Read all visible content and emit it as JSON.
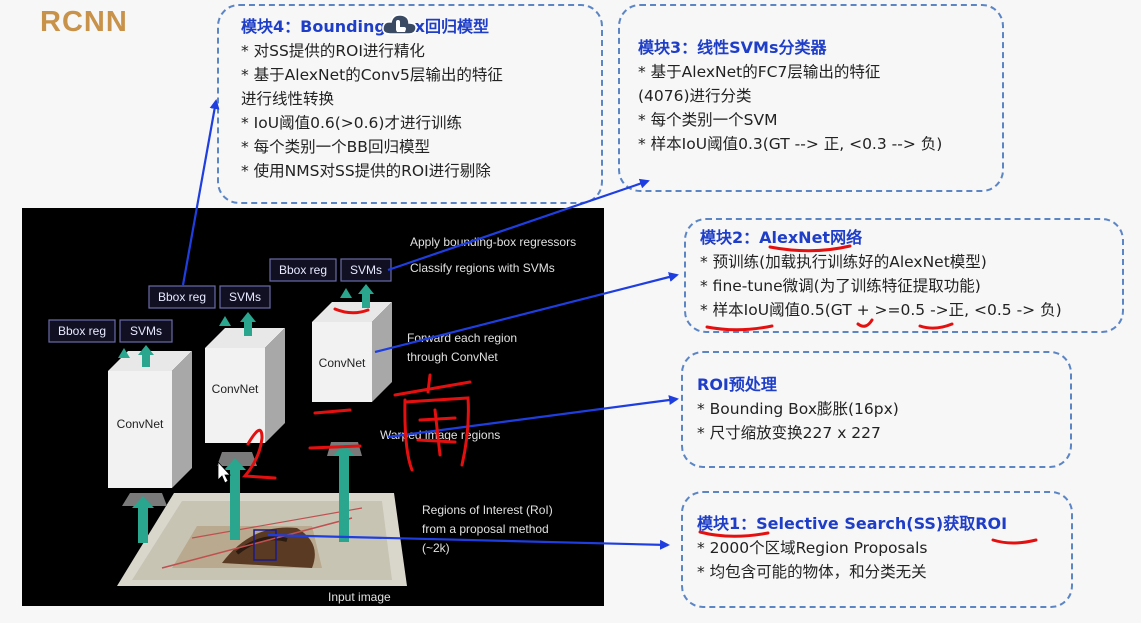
{
  "title": "RCNN",
  "module4": {
    "head": "模块4：Bounding Box回归模型",
    "lines": [
      "* 对SS提供的ROI进行精化",
      "* 基于AlexNet的Conv5层输出的特征",
      "进行线性转换",
      "* IoU阈值0.6(>0.6)才进行训练",
      "* 每个类别一个BB回归模型",
      "* 使用NMS对SS提供的ROI进行剔除"
    ]
  },
  "module3": {
    "head": "模块3：线性SVMs分类器",
    "lines": [
      "* 基于AlexNet的FC7层输出的特征",
      "(4076)进行分类",
      "* 每个类别一个SVM",
      "* 样本IoU阈值0.3(GT --> 正, <0.3 --> 负)"
    ]
  },
  "module2": {
    "head": "模块2：AlexNet网络",
    "lines": [
      "* 预训练(加载执行训练好的AlexNet模型)",
      "* fine-tune微调(为了训练特征提取功能)",
      "* 样本IoU阈值0.5(GT + >=0.5 ->正, <0.5 -> 负)"
    ]
  },
  "roi": {
    "head": "ROI预处理",
    "lines": [
      "* Bounding Box膨胀(16px)",
      "* 尺寸缩放变换227 x 227"
    ]
  },
  "module1": {
    "head": "模块1：Selective Search(SS)获取ROI",
    "lines": [
      "* 2000个区域Region Proposals",
      "* 均包含可能的物体，和分类无关"
    ]
  },
  "figure": {
    "bbox_reg": "Bbox reg",
    "svms": "SVMs",
    "convnet": "ConvNet",
    "apply_bbox": "Apply bounding-box regressors",
    "classify": "Classify regions with SVMs",
    "forward1": "Forward each region",
    "forward2": "through ConvNet",
    "warped": "Warped image regions",
    "roi1": "Regions of Interest (RoI)",
    "roi2": "from a proposal method",
    "roi3": "(~2k)",
    "input": "Input image"
  },
  "colors": {
    "title": "#c8924a",
    "head": "#1f3ec8",
    "border": "#5b85c5",
    "arrow": "#1f3ee0",
    "annotation": "#e41010",
    "teal": "#2aa58e"
  }
}
